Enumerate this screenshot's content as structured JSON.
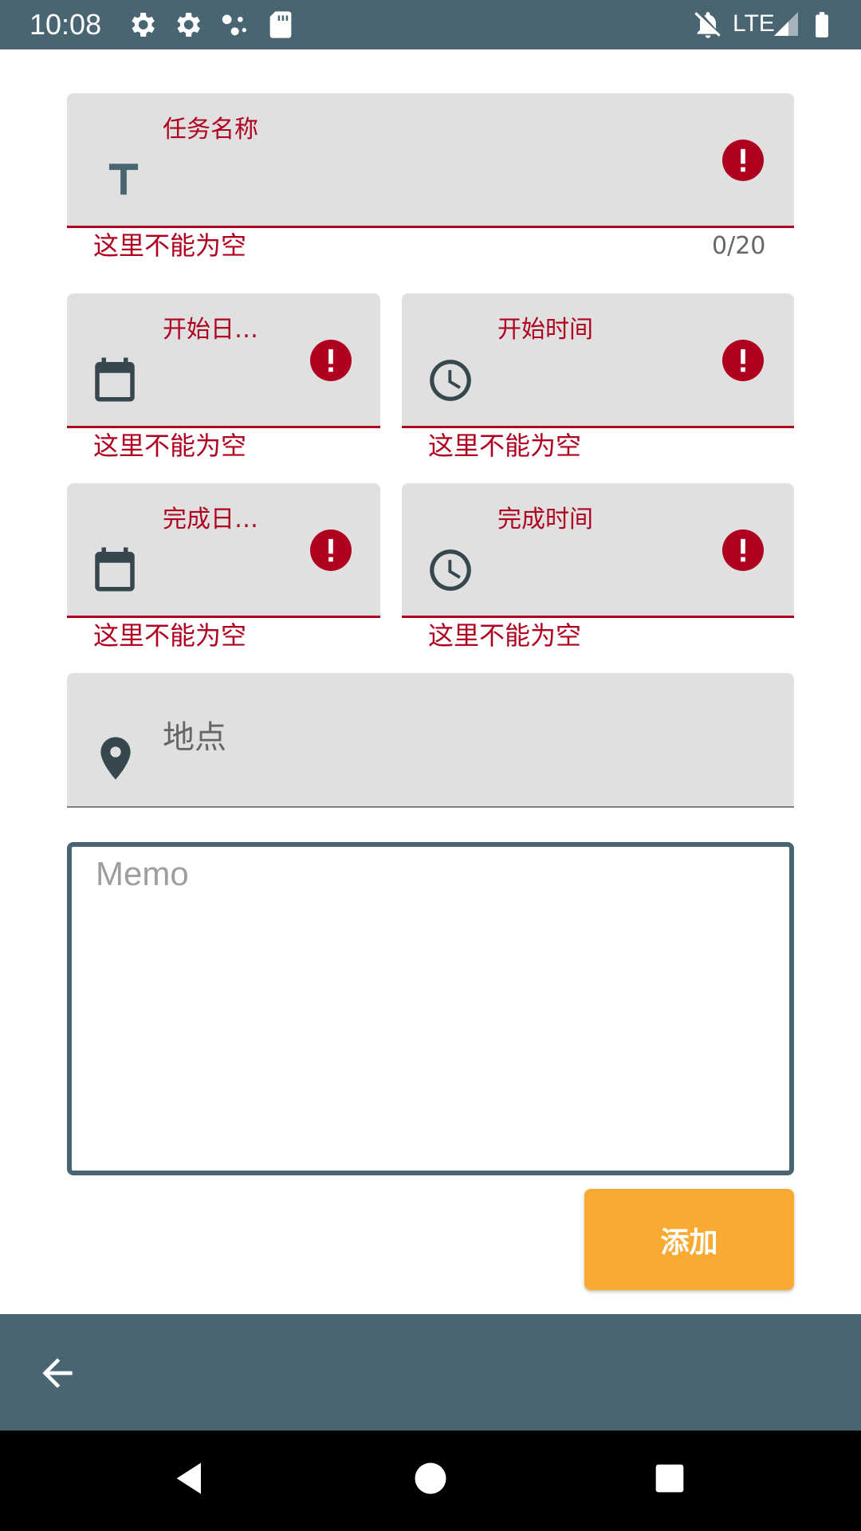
{
  "status_bar": {
    "time": "10:08",
    "network": "LTE",
    "icons": [
      "settings-icon",
      "settings-icon",
      "assistant-icon",
      "sd-card-icon",
      "notifications-off-icon",
      "signal-icon",
      "battery-icon"
    ]
  },
  "form": {
    "task_name": {
      "label": "任务名称",
      "value": "",
      "error": "这里不能为空",
      "counter": "0/20",
      "icon": "title-text-icon"
    },
    "start_date": {
      "label": "开始日…",
      "value": "",
      "error": "这里不能为空",
      "icon": "calendar-icon"
    },
    "start_time": {
      "label": "开始时间",
      "value": "",
      "error": "这里不能为空",
      "icon": "clock-icon"
    },
    "finish_date": {
      "label": "完成日…",
      "value": "",
      "error": "这里不能为空",
      "icon": "calendar-icon"
    },
    "finish_time": {
      "label": "完成时间",
      "value": "",
      "error": "这里不能为空",
      "icon": "clock-icon"
    },
    "location": {
      "placeholder": "地点",
      "value": "",
      "icon": "location-pin-icon"
    },
    "memo": {
      "placeholder": "Memo",
      "value": ""
    },
    "add_button": "添加"
  },
  "bottom_bar": {
    "back_icon": "arrow-back-icon"
  },
  "nav_bar": {
    "icons": [
      "nav-back-icon",
      "nav-home-icon",
      "nav-recents-icon"
    ]
  },
  "colors": {
    "primary": "#4a6572",
    "accent": "#f9aa33",
    "error": "#b00020",
    "field_bg": "#e0e0e0"
  }
}
